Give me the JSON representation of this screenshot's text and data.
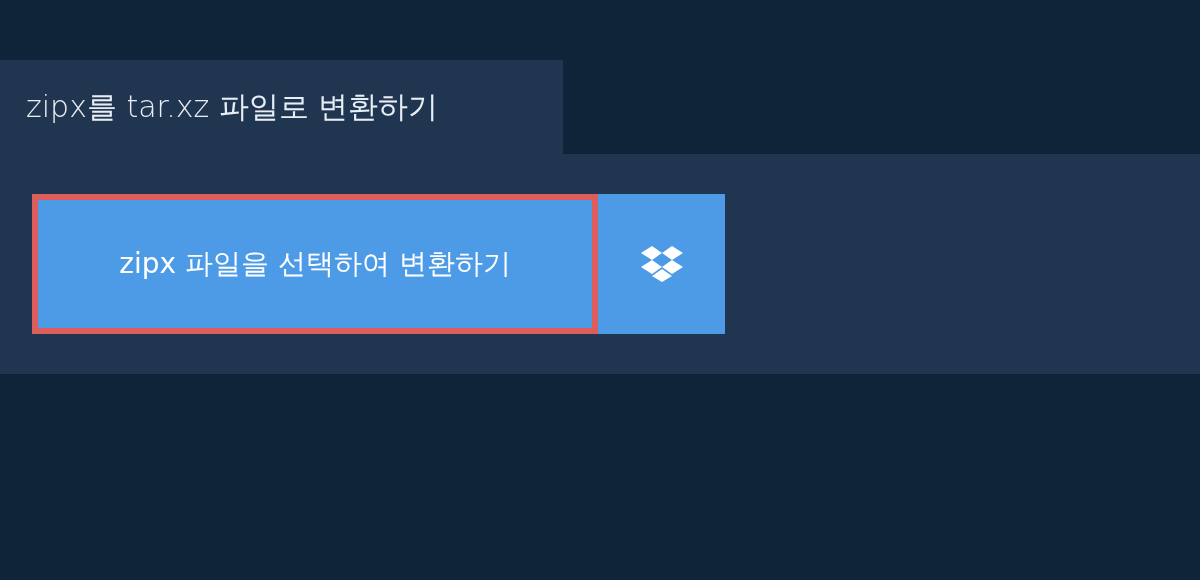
{
  "title": "zipx를 tar.xz 파일로 변환하기",
  "upload_button": {
    "label": "zipx 파일을 선택하여 변환하기",
    "highlighted": true
  }
}
